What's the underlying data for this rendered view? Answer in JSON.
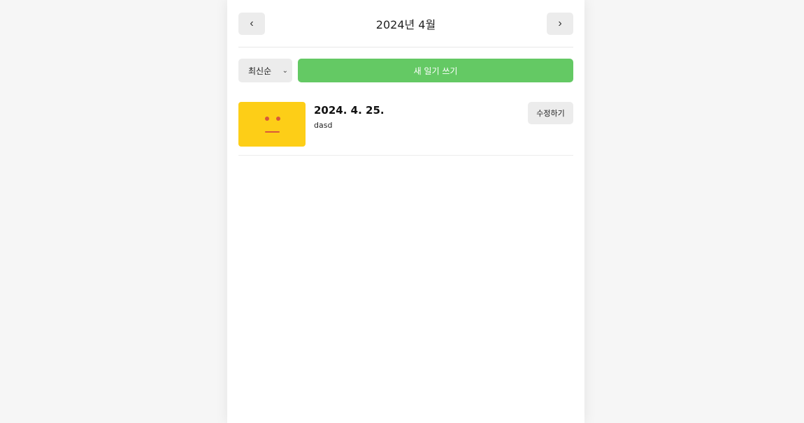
{
  "header": {
    "title": "2024년 4월",
    "prev_label": "‹",
    "next_label": "›"
  },
  "menu": {
    "sort_selected": "최신순",
    "new_diary_label": "새 일기 쓰기"
  },
  "diaries": [
    {
      "date": "2024. 4. 25.",
      "content": "dasd",
      "emotion_color": "#fdce17",
      "edit_label": "수정하기"
    }
  ],
  "colors": {
    "accent_green": "#64c964",
    "emotion_yellow": "#fdce17",
    "page_background": "#f6f6f6",
    "button_gray": "#ececec"
  }
}
